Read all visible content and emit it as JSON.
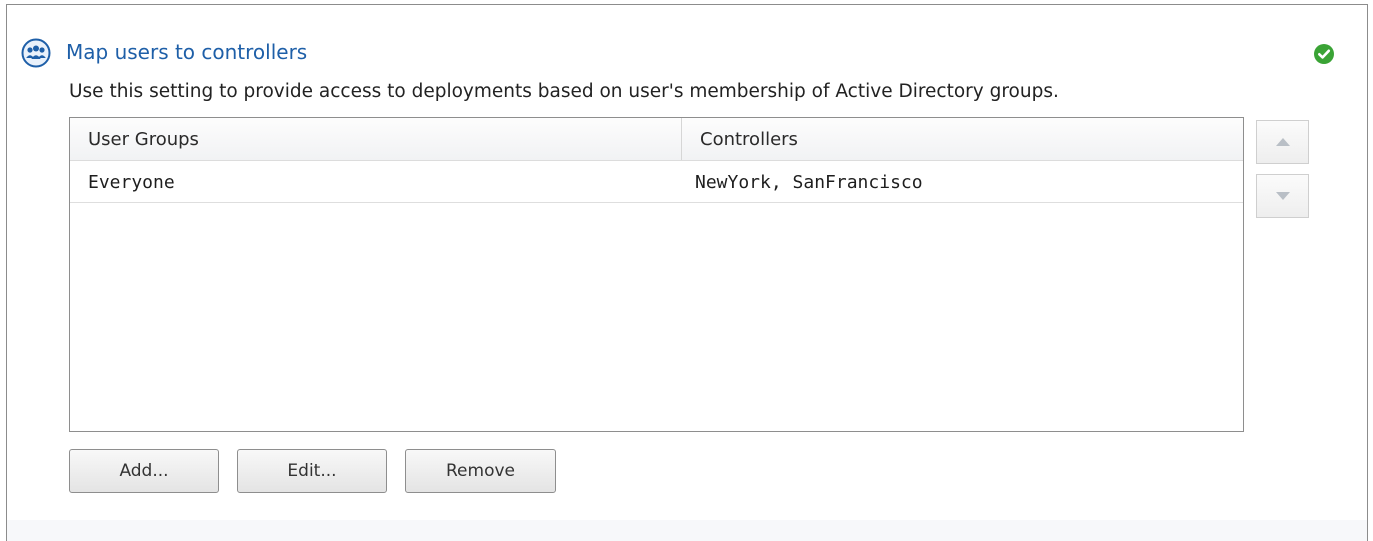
{
  "section": {
    "title": "Map users to controllers",
    "description": "Use this setting to provide access to deployments based on user's membership of Active Directory groups.",
    "icon": "users-group-icon",
    "status_icon": "check-circle-icon",
    "status_color": "#3aa335",
    "title_color": "#1e5fa8"
  },
  "table": {
    "columns": [
      "User Groups",
      "Controllers"
    ],
    "rows": [
      {
        "user_group": "Everyone",
        "controllers": "NewYork, SanFrancisco"
      }
    ]
  },
  "move_buttons": {
    "up_icon": "triangle-up-icon",
    "down_icon": "triangle-down-icon"
  },
  "actions": {
    "add_label": "Add...",
    "edit_label": "Edit...",
    "remove_label": "Remove"
  }
}
